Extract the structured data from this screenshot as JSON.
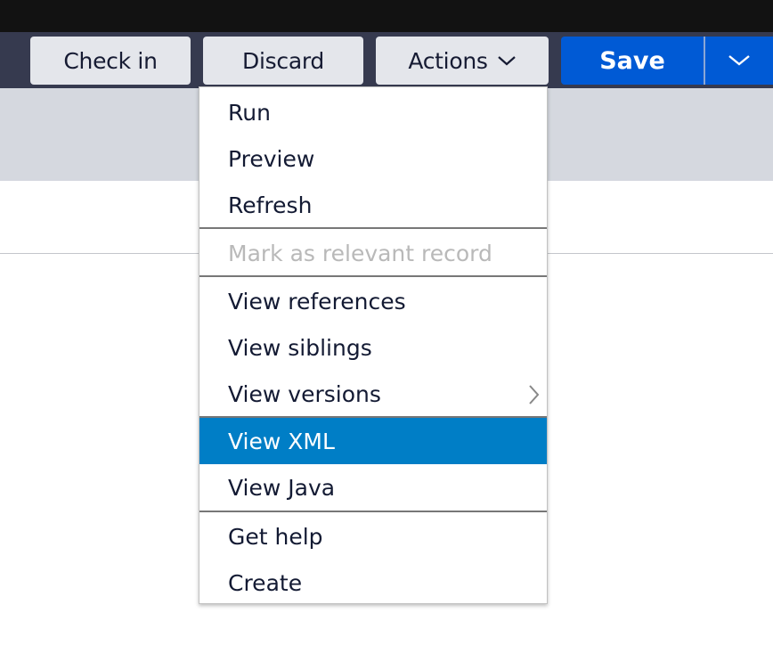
{
  "toolbar": {
    "check_in_label": "Check in",
    "discard_label": "Discard",
    "actions_label": "Actions",
    "actions_icon": "chevron-down-icon",
    "save_label": "Save",
    "save_menu_icon": "chevron-down-icon"
  },
  "colors": {
    "save_primary": "#005ad5",
    "menu_highlight": "#007ec6",
    "toolbar_bg": "#363a4f"
  },
  "actions_menu": {
    "items": [
      {
        "label": "Run",
        "state": "normal"
      },
      {
        "label": "Preview",
        "state": "normal"
      },
      {
        "label": "Refresh",
        "state": "normal"
      },
      {
        "label": "Mark as relevant record",
        "state": "disabled"
      },
      {
        "label": "View references",
        "state": "normal"
      },
      {
        "label": "View siblings",
        "state": "normal"
      },
      {
        "label": "View versions",
        "state": "normal",
        "submenu_icon": "chevron-right-icon"
      },
      {
        "label": "View XML",
        "state": "highlighted"
      },
      {
        "label": "View Java",
        "state": "normal"
      },
      {
        "label": "Get help",
        "state": "normal"
      },
      {
        "label": "Create",
        "state": "normal"
      }
    ]
  }
}
